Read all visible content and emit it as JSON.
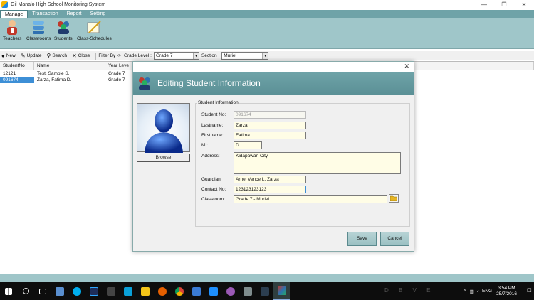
{
  "window": {
    "title": "Gil Manalo High School Monitoring System"
  },
  "menubar": {
    "items": [
      "Manage",
      "Transaction",
      "Report",
      "Setting"
    ]
  },
  "ribbon": {
    "buttons": [
      "Teachers",
      "Classrooms",
      "Students",
      "Class-Schedules"
    ]
  },
  "toolbar": {
    "new": "New",
    "update": "Update",
    "search": "Search",
    "close": "Close",
    "filter_by": "Filter By ->",
    "grade_level_label": "Grade Level :",
    "grade_level_value": "Grade 7",
    "section_label": "Section :",
    "section_value": "Muriel"
  },
  "grid": {
    "columns": [
      "StudentNo",
      "Name",
      "Year Leve"
    ],
    "rows": [
      {
        "no": "12121",
        "name": "Test, Sample S.",
        "year": "Grade 7"
      },
      {
        "no": "091674",
        "name": "Zarza, Fatima D.",
        "year": "Grade 7"
      }
    ]
  },
  "dialog": {
    "title": "Editing Student Information",
    "group_label": "Student Information",
    "browse_label": "Browse",
    "fields": {
      "student_no": {
        "label": "Student No:",
        "value": "091674"
      },
      "lastname": {
        "label": "Lastname:",
        "value": "Zarza"
      },
      "firstname": {
        "label": "Firstname:",
        "value": "Fatima"
      },
      "mi": {
        "label": "MI:",
        "value": "D"
      },
      "address": {
        "label": "Address:",
        "value": "Kidapawan City"
      },
      "guardian": {
        "label": "Guardian:",
        "value": "Arnel Vence L. Zarza"
      },
      "contact": {
        "label": "Contact No:",
        "value": "123123123123"
      },
      "classroom": {
        "label": "Classroom:",
        "value": "Grade 7 - Muriel"
      }
    },
    "save_label": "Save",
    "cancel_label": "Cancel"
  },
  "taskbar": {
    "watermark": "D B V E",
    "lang": "ENG",
    "time": "3:54 PM",
    "date": "25/7/2016"
  },
  "colors": {
    "accent": "#6fa3a8",
    "ribbon": "#9fc6c9",
    "selection": "#3d8fd6"
  }
}
